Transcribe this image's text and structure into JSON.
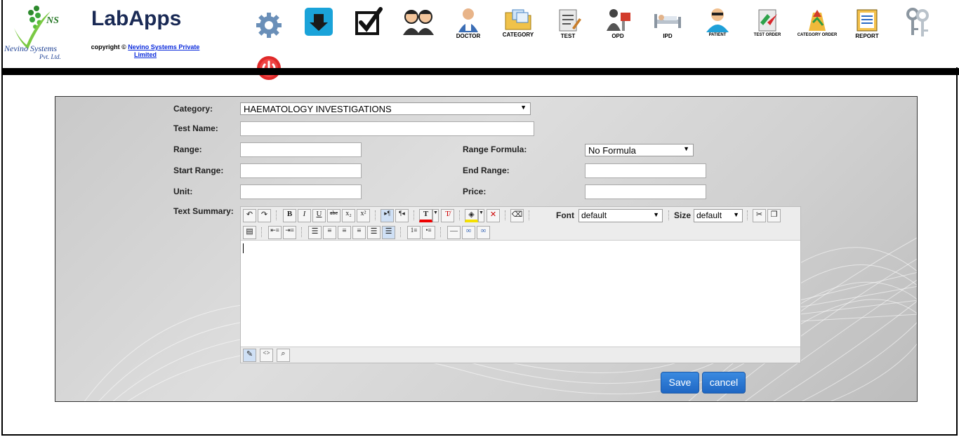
{
  "header": {
    "logo": {
      "ns": "NS",
      "nevino": "Nevino Systems",
      "pvt": "Pvt. Ltd."
    },
    "brand": "LabApps",
    "copyright_prefix": "copyright ©",
    "copyright_link": "Nevino Systems Private Limited",
    "nav": [
      {
        "label": "",
        "icon": "gear-icon"
      },
      {
        "label": "",
        "icon": "download-icon"
      },
      {
        "label": "",
        "icon": "checkbox-icon"
      },
      {
        "label": "",
        "icon": "users-icon"
      },
      {
        "label": "DOCTOR",
        "icon": "doctor-icon"
      },
      {
        "label": "CATEGORY",
        "icon": "folder-icon"
      },
      {
        "label": "TEST",
        "icon": "notepad-icon"
      },
      {
        "label": "OPD",
        "icon": "opd-icon"
      },
      {
        "label": "IPD",
        "icon": "bed-icon"
      },
      {
        "label": "PATIENT",
        "icon": "patient-icon"
      },
      {
        "label": "TEST ORDER",
        "icon": "test-order-icon"
      },
      {
        "label": "CATEGORY ORDER",
        "icon": "category-order-icon"
      },
      {
        "label": "REPORT",
        "icon": "report-icon"
      },
      {
        "label": "",
        "icon": "keys-icon"
      }
    ],
    "power_icon": "power-icon"
  },
  "form": {
    "category_label": "Category:",
    "category_value": "HAEMATOLOGY INVESTIGATIONS",
    "test_name_label": "Test Name:",
    "test_name_value": "",
    "range_label": "Range:",
    "range_value": "",
    "range_formula_label": "Range Formula:",
    "range_formula_value": "No Formula",
    "start_range_label": "Start Range:",
    "start_range_value": "",
    "end_range_label": "End Range:",
    "end_range_value": "",
    "unit_label": "Unit:",
    "unit_value": "",
    "price_label": "Price:",
    "price_value": "",
    "text_summary_label": "Text Summary:"
  },
  "editor": {
    "font_label": "Font",
    "font_value": "default",
    "size_label": "Size",
    "size_value": "default",
    "bold": "B",
    "italic": "I",
    "underline": "U",
    "strike": "abc",
    "content": ""
  },
  "actions": {
    "save": "Save",
    "cancel": "cancel"
  }
}
